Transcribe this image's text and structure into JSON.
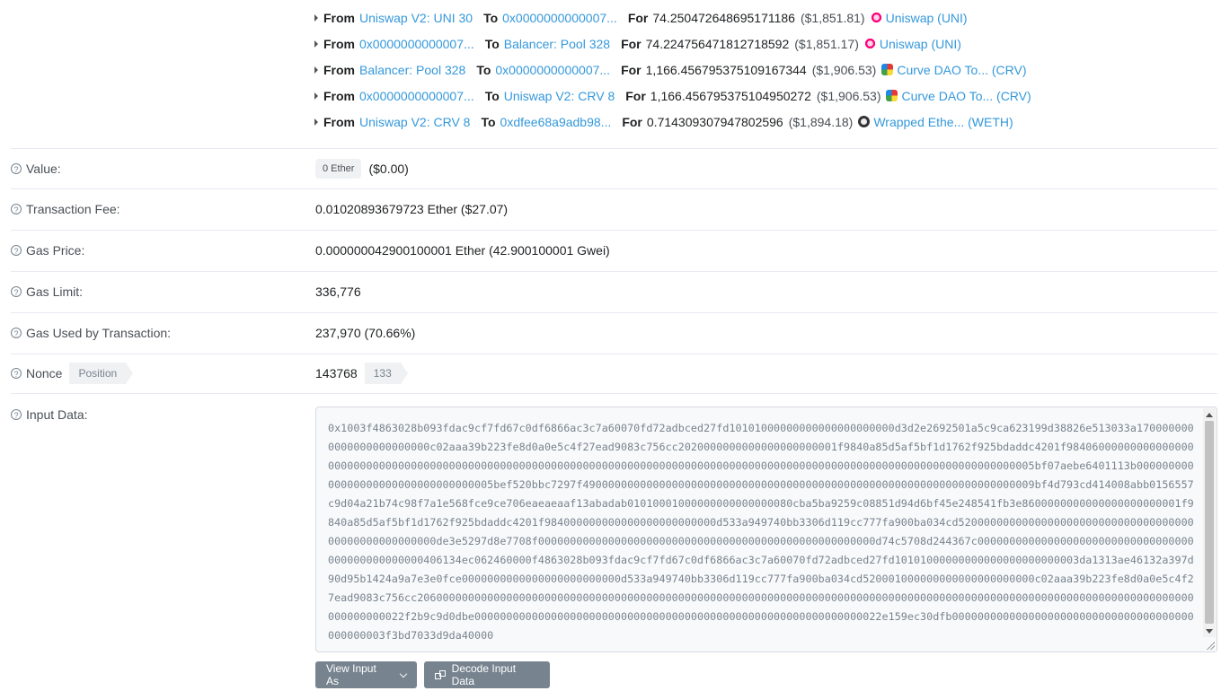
{
  "transfers": [
    {
      "from_label": "From",
      "from": "Uniswap V2: UNI 30",
      "to_label": "To",
      "to": "0x0000000000007...",
      "for_label": "For",
      "amount": "74.250472648695171186",
      "usd": "($1,851.81)",
      "token_icon": "uniswap-icon",
      "token": "Uniswap (UNI)"
    },
    {
      "from_label": "From",
      "from": "0x0000000000007...",
      "to_label": "To",
      "to": "Balancer: Pool 328",
      "for_label": "For",
      "amount": "74.224756471812718592",
      "usd": "($1,851.17)",
      "token_icon": "uniswap-icon",
      "token": "Uniswap (UNI)"
    },
    {
      "from_label": "From",
      "from": "Balancer: Pool 328",
      "to_label": "To",
      "to": "0x0000000000007...",
      "for_label": "For",
      "amount": "1,166.456795375109167344",
      "usd": "($1,906.53)",
      "token_icon": "curve-icon",
      "token": "Curve DAO To... (CRV)"
    },
    {
      "from_label": "From",
      "from": "0x0000000000007...",
      "to_label": "To",
      "to": "Uniswap V2: CRV 8",
      "for_label": "For",
      "amount": "1,166.456795375104950272",
      "usd": "($1,906.53)",
      "token_icon": "curve-icon",
      "token": "Curve DAO To... (CRV)"
    },
    {
      "from_label": "From",
      "from": "Uniswap V2: CRV 8",
      "to_label": "To",
      "to": "0xdfee68a9adb98...",
      "for_label": "For",
      "amount": "0.714309307947802596",
      "usd": "($1,894.18)",
      "token_icon": "weth-icon",
      "token": "Wrapped Ethe... (WETH)"
    }
  ],
  "value": {
    "label": "Value:",
    "badge": "0 Ether",
    "usd": "($0.00)"
  },
  "fee": {
    "label": "Transaction Fee:",
    "value": "0.01020893679723 Ether ($27.07)"
  },
  "gas_price": {
    "label": "Gas Price:",
    "value": "0.000000042900100001 Ether (42.900100001 Gwei)"
  },
  "gas_limit": {
    "label": "Gas Limit:",
    "value": "336,776"
  },
  "gas_used": {
    "label": "Gas Used by Transaction:",
    "value": "237,970 (70.66%)"
  },
  "nonce": {
    "label": "Nonce",
    "position_tag": "Position",
    "value": "143768",
    "position": "133"
  },
  "input_data": {
    "label": "Input Data:",
    "hex": "0x1003f4863028b093fdac9cf7fd67c0df6866ac3c7a60070fd72adbced27fd10101000000000000000000000d3d2e2692501a5c9ca623199d38826e513033a1700000000000000000000000c02aaa39b223fe8d0a0e5c4f27ead9083c756cc2020000000000000000000001f9840a85d5af5bf1d1762f925bdaddc4201f98406000000000000000000000000000000000000000000000000000000000000000000000000000000000000000000000000000000000000000000000000000005bf07aebe6401113b00000000000000000000000000000000005bef520bbc7297f49000000000000000000000000000000000000000000000000000000000000000000009bf4d793cd414008abb0156557c9d04a21b74c98f7a1e568fce9ce706eaeaeaaf13abadab01010001000000000000000080cba5ba9259c08851d94d6bf45e248541fb3e8600000000000000000000001f9840a85d5af5bf1d1762f925bdaddc4201f984000000000000000000000000d533a949740bb3306d119cc777fa900ba034cd520000000000000000000000000000000000000000000000000000de3e5297d8e7708f00000000000000000000000000000000000000000000000000000d74c5708d244367c0000000000000000000000000000000000000000000000000406134ec062460000f4863028b093fdac9cf7fd67c0df6866ac3c7a60070fd72adbced27fd10101000000000000000000000003da1313ae46132a397d90d95b1424a9a7e3e0fce0000000000000000000000000d533a949740bb3306d119cc777fa900ba034cd520001000000000000000000000c02aaa39b223fe8d0a0e5c4f27ead9083c756cc20600000000000000000000000000000000000000000000000000000000000000000000000000000000000000000000000000000000000000000000000000000000022f2b9c9d0dbe0000000000000000000000000000000000000000000000000000000000000022e159ec30dfb00000000000000000000000000000000000000000000003f3bd7033d9da40000"
  },
  "buttons": {
    "view_input": "View Input As",
    "decode_input": "Decode Input Data"
  }
}
